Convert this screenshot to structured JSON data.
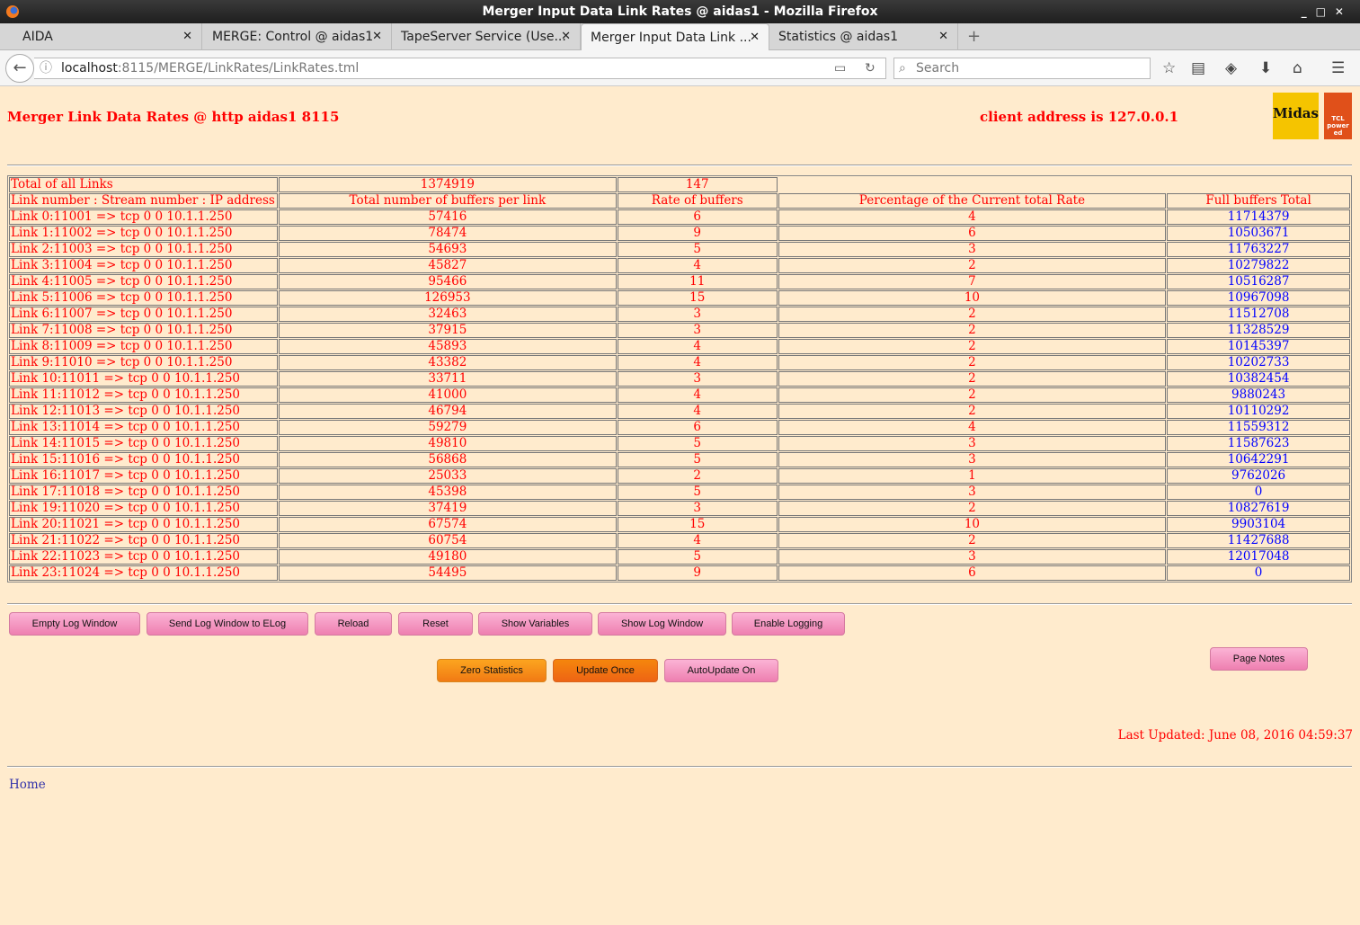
{
  "window": {
    "title": "Merger Input Data Link Rates @ aidas1 - Mozilla Firefox"
  },
  "tabs": [
    {
      "label": "AIDA"
    },
    {
      "label": "MERGE: Control @ aidas1"
    },
    {
      "label": "TapeServer Service (Use..."
    },
    {
      "label": "Merger Input Data Link ..."
    },
    {
      "label": "Statistics @ aidas1"
    }
  ],
  "nav": {
    "url_host": "localhost",
    "url_path": ":8115/MERGE/LinkRates/LinkRates.tml",
    "search_placeholder": "Search"
  },
  "page": {
    "title": "Merger Link Data Rates @ http aidas1 8115",
    "client": "client address is 127.0.0.1",
    "logo1": "Midas",
    "logo2": "TCL powered"
  },
  "table": {
    "total": {
      "label": "Total of all Links",
      "buffers": "1374919",
      "rate": "147"
    },
    "headers": [
      "Link number : Stream number : IP address",
      "Total number of buffers per link",
      "Rate of buffers",
      "Percentage of the Current total Rate",
      "Full buffers Total"
    ],
    "rows": [
      [
        "Link 0:11001 => tcp 0 0 10.1.1.250",
        "57416",
        "6",
        "4",
        "11714379"
      ],
      [
        "Link 1:11002 => tcp 0 0 10.1.1.250",
        "78474",
        "9",
        "6",
        "10503671"
      ],
      [
        "Link 2:11003 => tcp 0 0 10.1.1.250",
        "54693",
        "5",
        "3",
        "11763227"
      ],
      [
        "Link 3:11004 => tcp 0 0 10.1.1.250",
        "45827",
        "4",
        "2",
        "10279822"
      ],
      [
        "Link 4:11005 => tcp 0 0 10.1.1.250",
        "95466",
        "11",
        "7",
        "10516287"
      ],
      [
        "Link 5:11006 => tcp 0 0 10.1.1.250",
        "126953",
        "15",
        "10",
        "10967098"
      ],
      [
        "Link 6:11007 => tcp 0 0 10.1.1.250",
        "32463",
        "3",
        "2",
        "11512708"
      ],
      [
        "Link 7:11008 => tcp 0 0 10.1.1.250",
        "37915",
        "3",
        "2",
        "11328529"
      ],
      [
        "Link 8:11009 => tcp 0 0 10.1.1.250",
        "45893",
        "4",
        "2",
        "10145397"
      ],
      [
        "Link 9:11010 => tcp 0 0 10.1.1.250",
        "43382",
        "4",
        "2",
        "10202733"
      ],
      [
        "Link 10:11011 => tcp 0 0 10.1.1.250",
        "33711",
        "3",
        "2",
        "10382454"
      ],
      [
        "Link 11:11012 => tcp 0 0 10.1.1.250",
        "41000",
        "4",
        "2",
        "9880243"
      ],
      [
        "Link 12:11013 => tcp 0 0 10.1.1.250",
        "46794",
        "4",
        "2",
        "10110292"
      ],
      [
        "Link 13:11014 => tcp 0 0 10.1.1.250",
        "59279",
        "6",
        "4",
        "11559312"
      ],
      [
        "Link 14:11015 => tcp 0 0 10.1.1.250",
        "49810",
        "5",
        "3",
        "11587623"
      ],
      [
        "Link 15:11016 => tcp 0 0 10.1.1.250",
        "56868",
        "5",
        "3",
        "10642291"
      ],
      [
        "Link 16:11017 => tcp 0 0 10.1.1.250",
        "25033",
        "2",
        "1",
        "9762026"
      ],
      [
        "Link 17:11018 => tcp 0 0 10.1.1.250",
        "45398",
        "5",
        "3",
        "0"
      ],
      [
        "Link 19:11020 => tcp 0 0 10.1.1.250",
        "37419",
        "3",
        "2",
        "10827619"
      ],
      [
        "Link 20:11021 => tcp 0 0 10.1.1.250",
        "67574",
        "15",
        "10",
        "9903104"
      ],
      [
        "Link 21:11022 => tcp 0 0 10.1.1.250",
        "60754",
        "4",
        "2",
        "11427688"
      ],
      [
        "Link 22:11023 => tcp 0 0 10.1.1.250",
        "49180",
        "5",
        "3",
        "12017048"
      ],
      [
        "Link 23:11024 => tcp 0 0 10.1.1.250",
        "54495",
        "9",
        "6",
        "0"
      ]
    ]
  },
  "buttons": {
    "empty_log": "Empty Log Window",
    "send_log": "Send Log Window to ELog",
    "reload": "Reload",
    "reset": "Reset",
    "show_vars": "Show Variables",
    "show_log": "Show Log Window",
    "enable_logging": "Enable Logging",
    "zero_stats": "Zero Statistics",
    "update_once": "Update Once",
    "autoupdate": "AutoUpdate On",
    "page_notes": "Page Notes"
  },
  "footer": {
    "last_updated": "Last Updated: June 08, 2016 04:59:37",
    "home": "Home"
  }
}
